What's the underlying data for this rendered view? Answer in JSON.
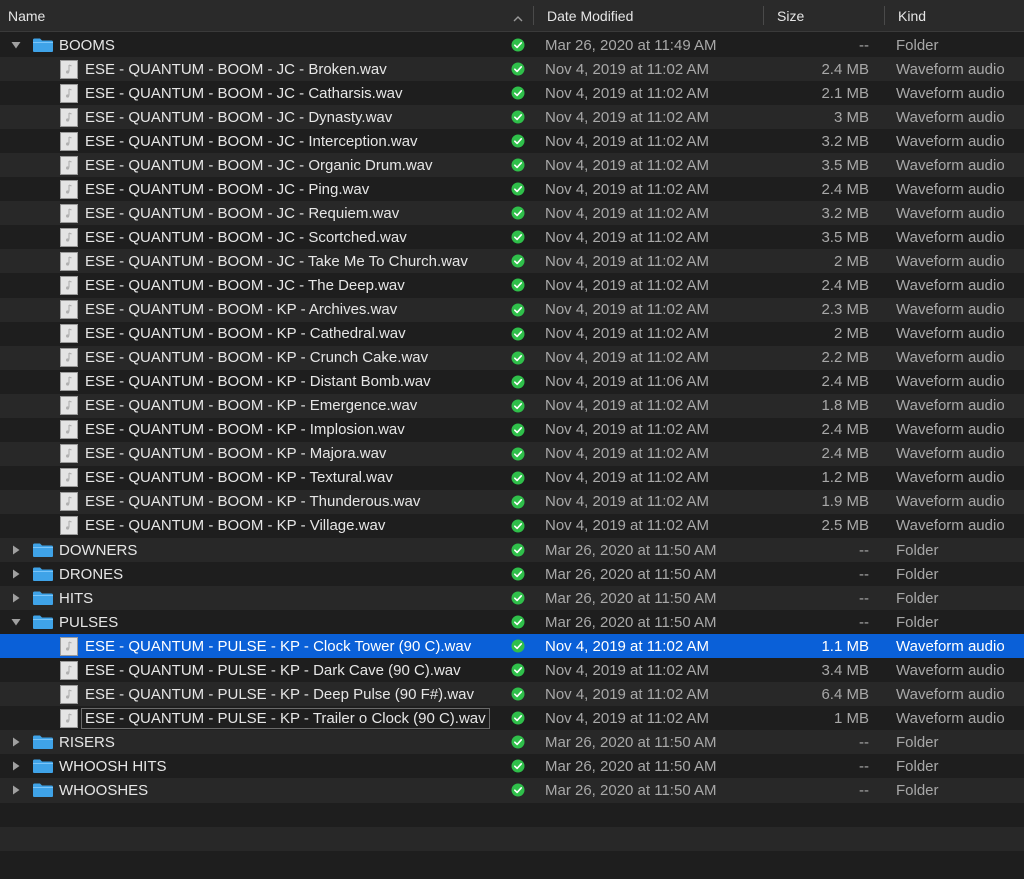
{
  "header": {
    "name": "Name",
    "date": "Date Modified",
    "size": "Size",
    "kind": "Kind"
  },
  "colors": {
    "selection": "#0a60d8",
    "folder": "#3fa3e8",
    "status_ok": "#2fbf4a"
  },
  "rows": [
    {
      "type": "folder",
      "expanded": true,
      "name": "BOOMS",
      "date": "Mar 26, 2020 at 11:49 AM",
      "size": "--",
      "kind": "Folder"
    },
    {
      "type": "file",
      "name": "ESE - QUANTUM - BOOM - JC - Broken.wav",
      "date": "Nov 4, 2019 at 11:02 AM",
      "size": "2.4 MB",
      "kind": "Waveform audio"
    },
    {
      "type": "file",
      "name": "ESE - QUANTUM - BOOM - JC - Catharsis.wav",
      "date": "Nov 4, 2019 at 11:02 AM",
      "size": "2.1 MB",
      "kind": "Waveform audio"
    },
    {
      "type": "file",
      "name": "ESE - QUANTUM - BOOM - JC - Dynasty.wav",
      "date": "Nov 4, 2019 at 11:02 AM",
      "size": "3 MB",
      "kind": "Waveform audio"
    },
    {
      "type": "file",
      "name": "ESE - QUANTUM - BOOM - JC - Interception.wav",
      "date": "Nov 4, 2019 at 11:02 AM",
      "size": "3.2 MB",
      "kind": "Waveform audio"
    },
    {
      "type": "file",
      "name": "ESE - QUANTUM - BOOM - JC - Organic Drum.wav",
      "date": "Nov 4, 2019 at 11:02 AM",
      "size": "3.5 MB",
      "kind": "Waveform audio"
    },
    {
      "type": "file",
      "name": "ESE - QUANTUM - BOOM - JC - Ping.wav",
      "date": "Nov 4, 2019 at 11:02 AM",
      "size": "2.4 MB",
      "kind": "Waveform audio"
    },
    {
      "type": "file",
      "name": "ESE - QUANTUM - BOOM - JC - Requiem.wav",
      "date": "Nov 4, 2019 at 11:02 AM",
      "size": "3.2 MB",
      "kind": "Waveform audio"
    },
    {
      "type": "file",
      "name": "ESE - QUANTUM - BOOM - JC - Scortched.wav",
      "date": "Nov 4, 2019 at 11:02 AM",
      "size": "3.5 MB",
      "kind": "Waveform audio"
    },
    {
      "type": "file",
      "name": "ESE - QUANTUM - BOOM - JC - Take Me To Church.wav",
      "date": "Nov 4, 2019 at 11:02 AM",
      "size": "2 MB",
      "kind": "Waveform audio"
    },
    {
      "type": "file",
      "name": "ESE - QUANTUM - BOOM - JC - The Deep.wav",
      "date": "Nov 4, 2019 at 11:02 AM",
      "size": "2.4 MB",
      "kind": "Waveform audio"
    },
    {
      "type": "file",
      "name": "ESE - QUANTUM - BOOM - KP - Archives.wav",
      "date": "Nov 4, 2019 at 11:02 AM",
      "size": "2.3 MB",
      "kind": "Waveform audio"
    },
    {
      "type": "file",
      "name": "ESE - QUANTUM - BOOM - KP - Cathedral.wav",
      "date": "Nov 4, 2019 at 11:02 AM",
      "size": "2 MB",
      "kind": "Waveform audio"
    },
    {
      "type": "file",
      "name": "ESE - QUANTUM - BOOM - KP - Crunch Cake.wav",
      "date": "Nov 4, 2019 at 11:02 AM",
      "size": "2.2 MB",
      "kind": "Waveform audio"
    },
    {
      "type": "file",
      "name": "ESE - QUANTUM - BOOM - KP - Distant Bomb.wav",
      "date": "Nov 4, 2019 at 11:06 AM",
      "size": "2.4 MB",
      "kind": "Waveform audio"
    },
    {
      "type": "file",
      "name": "ESE - QUANTUM - BOOM - KP - Emergence.wav",
      "date": "Nov 4, 2019 at 11:02 AM",
      "size": "1.8 MB",
      "kind": "Waveform audio"
    },
    {
      "type": "file",
      "name": "ESE - QUANTUM - BOOM - KP - Implosion.wav",
      "date": "Nov 4, 2019 at 11:02 AM",
      "size": "2.4 MB",
      "kind": "Waveform audio"
    },
    {
      "type": "file",
      "name": "ESE - QUANTUM - BOOM - KP - Majora.wav",
      "date": "Nov 4, 2019 at 11:02 AM",
      "size": "2.4 MB",
      "kind": "Waveform audio"
    },
    {
      "type": "file",
      "name": "ESE - QUANTUM - BOOM - KP - Textural.wav",
      "date": "Nov 4, 2019 at 11:02 AM",
      "size": "1.2 MB",
      "kind": "Waveform audio"
    },
    {
      "type": "file",
      "name": "ESE - QUANTUM - BOOM - KP - Thunderous.wav",
      "date": "Nov 4, 2019 at 11:02 AM",
      "size": "1.9 MB",
      "kind": "Waveform audio"
    },
    {
      "type": "file",
      "name": "ESE - QUANTUM - BOOM - KP - Village.wav",
      "date": "Nov 4, 2019 at 11:02 AM",
      "size": "2.5 MB",
      "kind": "Waveform audio"
    },
    {
      "type": "folder",
      "expanded": false,
      "name": "DOWNERS",
      "date": "Mar 26, 2020 at 11:50 AM",
      "size": "--",
      "kind": "Folder"
    },
    {
      "type": "folder",
      "expanded": false,
      "name": "DRONES",
      "date": "Mar 26, 2020 at 11:50 AM",
      "size": "--",
      "kind": "Folder"
    },
    {
      "type": "folder",
      "expanded": false,
      "name": "HITS",
      "date": "Mar 26, 2020 at 11:50 AM",
      "size": "--",
      "kind": "Folder"
    },
    {
      "type": "folder",
      "expanded": true,
      "name": "PULSES",
      "date": "Mar 26, 2020 at 11:50 AM",
      "size": "--",
      "kind": "Folder"
    },
    {
      "type": "file",
      "selected": true,
      "name": "ESE - QUANTUM - PULSE - KP - Clock Tower (90 C).wav",
      "date": "Nov 4, 2019 at 11:02 AM",
      "size": "1.1 MB",
      "kind": "Waveform audio"
    },
    {
      "type": "file",
      "name": "ESE - QUANTUM - PULSE - KP - Dark Cave (90 C).wav",
      "date": "Nov 4, 2019 at 11:02 AM",
      "size": "3.4 MB",
      "kind": "Waveform audio"
    },
    {
      "type": "file",
      "name": "ESE - QUANTUM - PULSE - KP - Deep Pulse (90 F#).wav",
      "date": "Nov 4, 2019 at 11:02 AM",
      "size": "6.4 MB",
      "kind": "Waveform audio"
    },
    {
      "type": "file",
      "boxed": true,
      "name": "ESE - QUANTUM - PULSE - KP - Trailer o Clock (90 C).wav",
      "date": "Nov 4, 2019 at 11:02 AM",
      "size": "1 MB",
      "kind": "Waveform audio"
    },
    {
      "type": "folder",
      "expanded": false,
      "name": "RISERS",
      "date": "Mar 26, 2020 at 11:50 AM",
      "size": "--",
      "kind": "Folder"
    },
    {
      "type": "folder",
      "expanded": false,
      "name": "WHOOSH HITS",
      "date": "Mar 26, 2020 at 11:50 AM",
      "size": "--",
      "kind": "Folder"
    },
    {
      "type": "folder",
      "expanded": false,
      "name": "WHOOSHES",
      "date": "Mar 26, 2020 at 11:50 AM",
      "size": "--",
      "kind": "Folder"
    }
  ]
}
